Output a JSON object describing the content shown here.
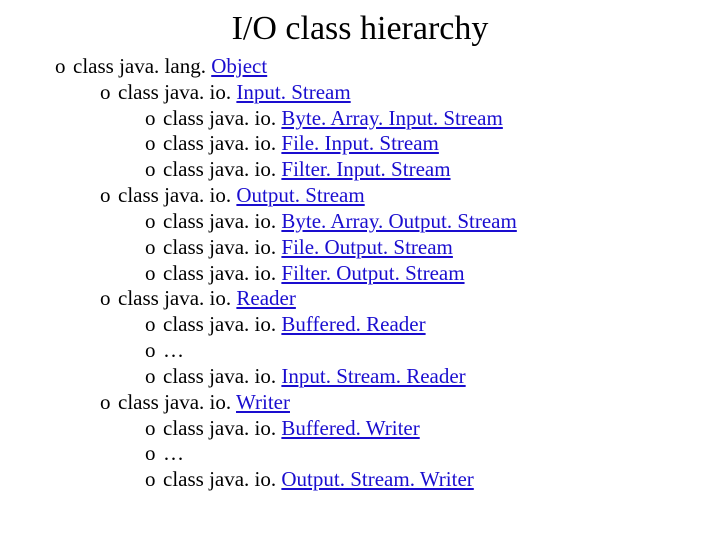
{
  "title": "I/O class hierarchy",
  "bullet": "o",
  "prefix": "class ",
  "nodes": {
    "object": {
      "plain": "java. lang. ",
      "link": "Object",
      "indent": 0
    },
    "inputstream": {
      "plain": "java. io. ",
      "link": "Input. Stream",
      "indent": 1
    },
    "bytearrayin": {
      "plain": "java. io. ",
      "link": "Byte. Array. Input. Stream",
      "indent": 2
    },
    "fileinput": {
      "plain": "java. io. ",
      "link": "File. Input. Stream",
      "indent": 2
    },
    "filterinput": {
      "plain": "java. io. ",
      "link": "Filter. Input. Stream",
      "indent": 2
    },
    "outputstream": {
      "plain": "java. io. ",
      "link": "Output. Stream",
      "indent": 1
    },
    "bytearrayout": {
      "plain": "java. io. ",
      "link": "Byte. Array. Output. Stream",
      "indent": 2
    },
    "fileoutput": {
      "plain": "java. io. ",
      "link": "File. Output. Stream",
      "indent": 2
    },
    "filteroutput": {
      "plain": "java. io. ",
      "link": "Filter. Output. Stream",
      "indent": 2
    },
    "reader": {
      "plain": "java. io. ",
      "link": "Reader",
      "indent": 1
    },
    "bufferedreader": {
      "plain": "java. io. ",
      "link": "Buffered. Reader",
      "indent": 2
    },
    "readerellipsis": {
      "plain": "…",
      "link": "",
      "indent": 2
    },
    "inputstreamreader": {
      "plain": "java. io. ",
      "link": "Input. Stream. Reader",
      "indent": 2
    },
    "writer": {
      "plain": "java. io. ",
      "link": "Writer",
      "indent": 1
    },
    "bufferedwriter": {
      "plain": "java. io. ",
      "link": "Buffered. Writer",
      "indent": 2
    },
    "writerellipsis": {
      "plain": "…",
      "link": "",
      "indent": 2
    },
    "outputstreamwriter": {
      "plain": "java. io. ",
      "link": "Output. Stream. Writer",
      "indent": 2
    }
  },
  "order": [
    "object",
    "inputstream",
    "bytearrayin",
    "fileinput",
    "filterinput",
    "outputstream",
    "bytearrayout",
    "fileoutput",
    "filteroutput",
    "reader",
    "bufferedreader",
    "readerellipsis",
    "inputstreamreader",
    "writer",
    "bufferedwriter",
    "writerellipsis",
    "outputstreamwriter"
  ]
}
